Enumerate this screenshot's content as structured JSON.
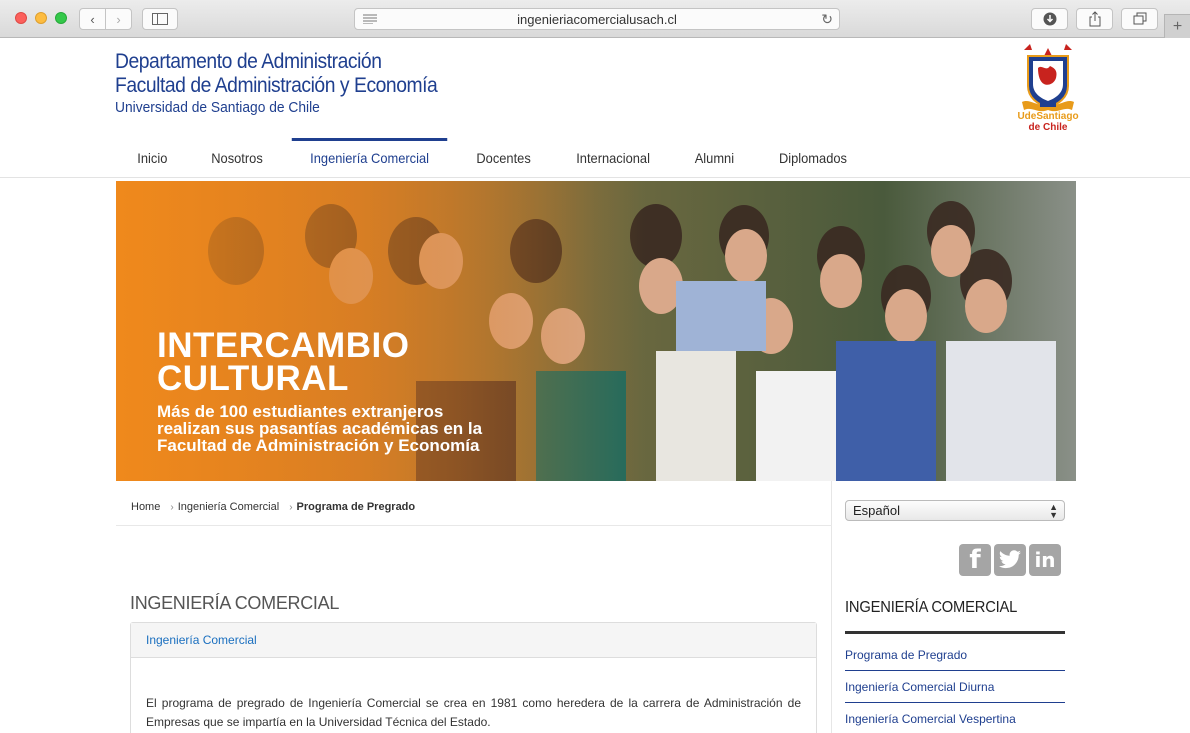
{
  "browser": {
    "url": "ingenieriacomercialusach.cl"
  },
  "header": {
    "dept_line1": "Departamento de Administración",
    "dept_line2": "Facultad de Administración y Economía",
    "dept_line3": "Universidad de Santiago de Chile",
    "logo_text_a": "UdeSantiago",
    "logo_text_b": "de Chile"
  },
  "nav": {
    "items": [
      {
        "label": "Inicio"
      },
      {
        "label": "Nosotros"
      },
      {
        "label": "Ingeniería Comercial",
        "active": true
      },
      {
        "label": "Docentes"
      },
      {
        "label": "Internacional"
      },
      {
        "label": "Alumni"
      },
      {
        "label": "Diplomados"
      }
    ]
  },
  "banner": {
    "title_line1": "INTERCAMBIO",
    "title_line2": "CULTURAL",
    "subtitle": "Más de 100 estudiantes extranjeros realizan sus pasantías académicas en la Facultad de Administración y Economía"
  },
  "breadcrumb": {
    "home": "Home",
    "section": "Ingeniería Comercial",
    "current": "Programa de Pregrado"
  },
  "main": {
    "title": "INGENIERÍA COMERCIAL",
    "panel_heading": "Ingeniería Comercial",
    "panel_text": "El programa de pregrado de Ingeniería Comercial se crea en 1981 como heredera de la carrera de Administración de Empresas que se impartía en la Universidad Técnica del Estado."
  },
  "sidebar": {
    "language": "Español",
    "social": {
      "facebook": "f",
      "linkedin": "in"
    },
    "title": "INGENIERÍA COMERCIAL",
    "links": [
      {
        "label": "Programa de Pregrado"
      },
      {
        "label": "Ingeniería Comercial Diurna"
      },
      {
        "label": "Ingeniería Comercial Vespertina"
      }
    ]
  },
  "colors": {
    "brand_blue": "#1f3f8f",
    "link_blue": "#1a6fbf",
    "banner_orange": "#e8821c"
  }
}
